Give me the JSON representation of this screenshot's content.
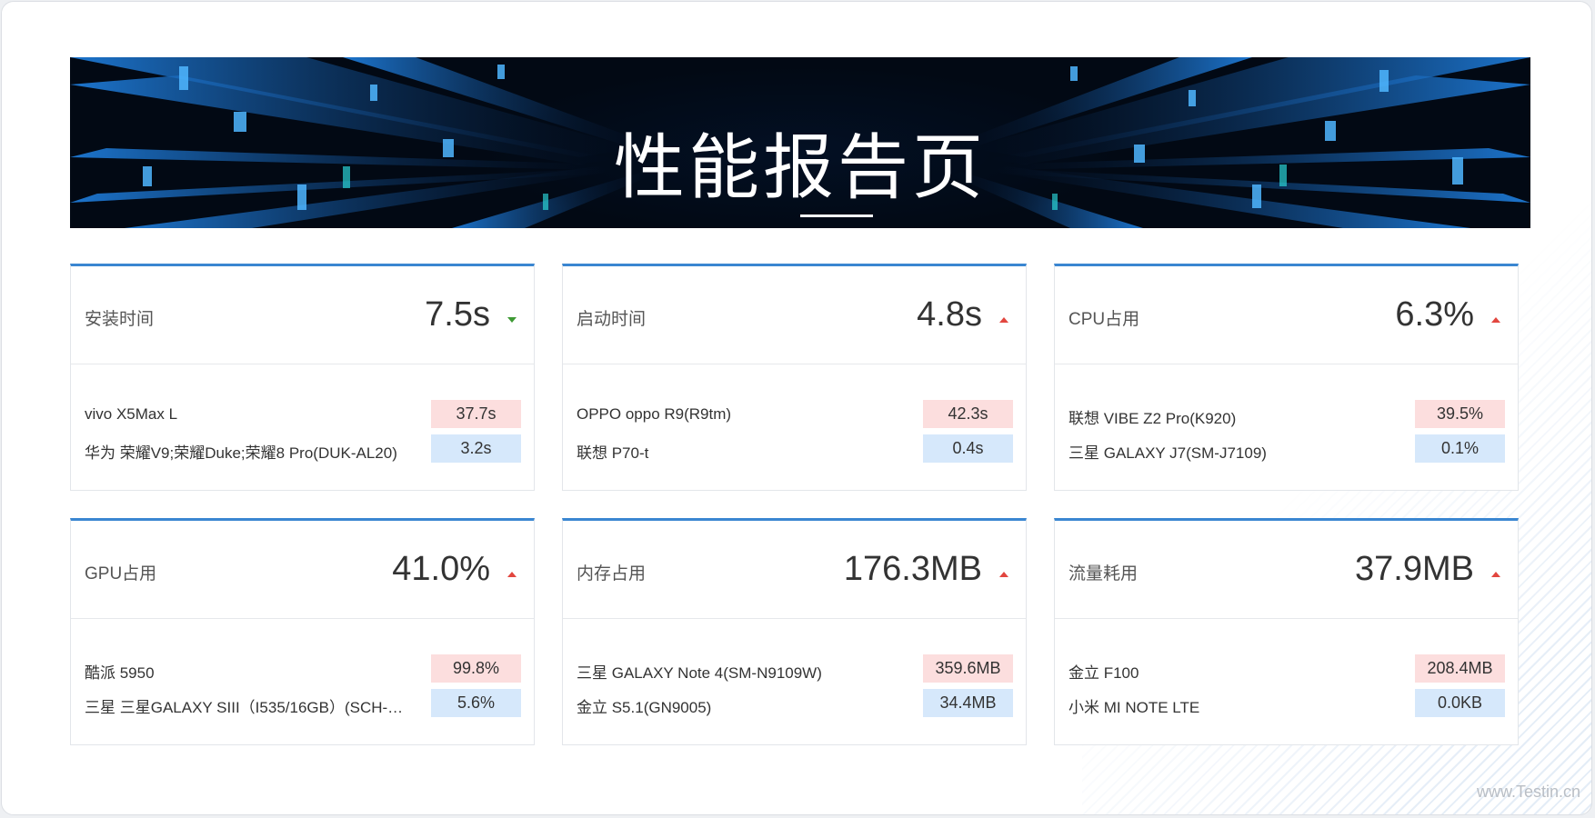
{
  "banner": {
    "title": "性能报告页"
  },
  "metrics": [
    {
      "label": "安装时间",
      "value": "7.5s",
      "trend": "down",
      "max": {
        "device": "vivo X5Max L",
        "value": "37.7s"
      },
      "min": {
        "device": "华为 荣耀V9;荣耀Duke;荣耀8 Pro(DUK-AL20)",
        "value": "3.2s"
      }
    },
    {
      "label": "启动时间",
      "value": "4.8s",
      "trend": "up",
      "max": {
        "device": "OPPO oppo R9(R9tm)",
        "value": "42.3s"
      },
      "min": {
        "device": "联想 P70-t",
        "value": "0.4s"
      }
    },
    {
      "label": "CPU占用",
      "value": "6.3%",
      "trend": "up",
      "max": {
        "device": "联想 VIBE Z2 Pro(K920)",
        "value": "39.5%"
      },
      "min": {
        "device": "三星 GALAXY J7(SM-J7109)",
        "value": "0.1%"
      }
    },
    {
      "label": "GPU占用",
      "value": "41.0%",
      "trend": "up",
      "max": {
        "device": "酷派 5950",
        "value": "99.8%"
      },
      "min": {
        "device": "三星 三星GALAXY SIII（I535/16GB）(SCH-…",
        "value": "5.6%"
      }
    },
    {
      "label": "内存占用",
      "value": "176.3MB",
      "trend": "up",
      "max": {
        "device": "三星 GALAXY Note 4(SM-N9109W)",
        "value": "359.6MB"
      },
      "min": {
        "device": "金立 S5.1(GN9005)",
        "value": "34.4MB"
      }
    },
    {
      "label": "流量耗用",
      "value": "37.9MB",
      "trend": "up",
      "max": {
        "device": "金立 F100",
        "value": "208.4MB"
      },
      "min": {
        "device": "小米 MI NOTE LTE",
        "value": "0.0KB"
      }
    }
  ],
  "colors": {
    "accent": "#3a86d1",
    "trend_up": "#e2463f",
    "trend_down": "#3e9a34",
    "max_bg": "#fcdede",
    "min_bg": "#d6e8fb"
  },
  "watermark": "www.Testin.cn"
}
